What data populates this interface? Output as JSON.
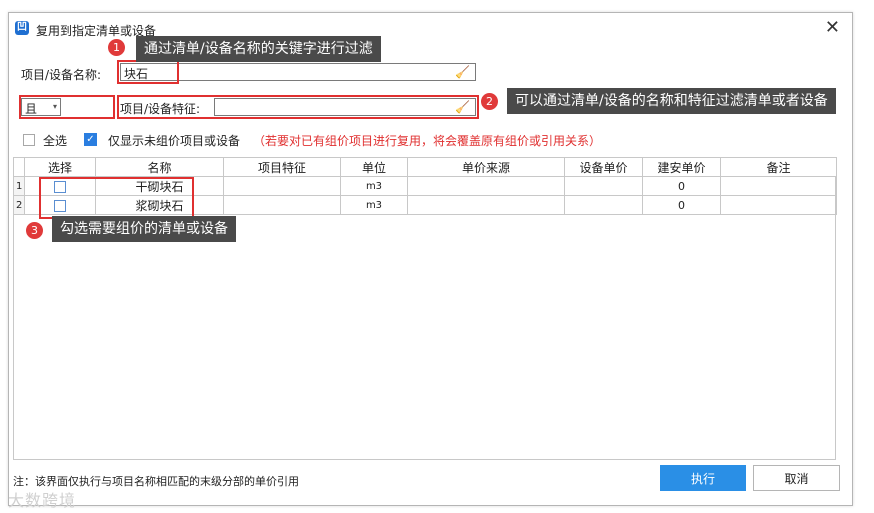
{
  "dialog": {
    "app_icon": "凹",
    "title": "复用到指定清单或设备",
    "close_label": "✕"
  },
  "filters": {
    "name_label": "项目/设备名称:",
    "name_value": "块石",
    "logic_value": "且",
    "feature_label": "项目/设备特征:",
    "feature_value": "",
    "broom_icon": "🧹"
  },
  "options": {
    "select_all_label": "全选",
    "show_unpriced_label": "仅显示未组价项目或设备",
    "show_unpriced_checked": true,
    "warning_text": "（若要对已有组价项目进行复用，将会覆盖原有组价或引用关系）",
    "warning_color": "#e03030"
  },
  "table": {
    "headers": [
      "选择",
      "名称",
      "项目特征",
      "单位",
      "单价来源",
      "设备单价",
      "建安单价",
      "备注"
    ],
    "rows": [
      {
        "num": "1",
        "name": "干砌块石",
        "feature": "",
        "unit": "m3",
        "source": "",
        "equip_price": "",
        "build_price": "0",
        "note": ""
      },
      {
        "num": "2",
        "name": "浆砌块石",
        "feature": "",
        "unit": "m3",
        "source": "",
        "equip_price": "",
        "build_price": "0",
        "note": ""
      }
    ]
  },
  "callouts": [
    {
      "num": "1",
      "text": "通过清单/设备名称的关键字进行过滤"
    },
    {
      "num": "2",
      "text": "可以通过清单/设备的名称和特征过滤清单或者设备"
    },
    {
      "num": "3",
      "text": "勾选需要组价的清单或设备"
    }
  ],
  "footer": {
    "note": "注：该界面仅执行与项目名称相匹配的末级分部的单价引用",
    "execute_label": "执行",
    "cancel_label": "取消",
    "primary_color": "#2a8fe6"
  },
  "watermark": "大数跨境"
}
